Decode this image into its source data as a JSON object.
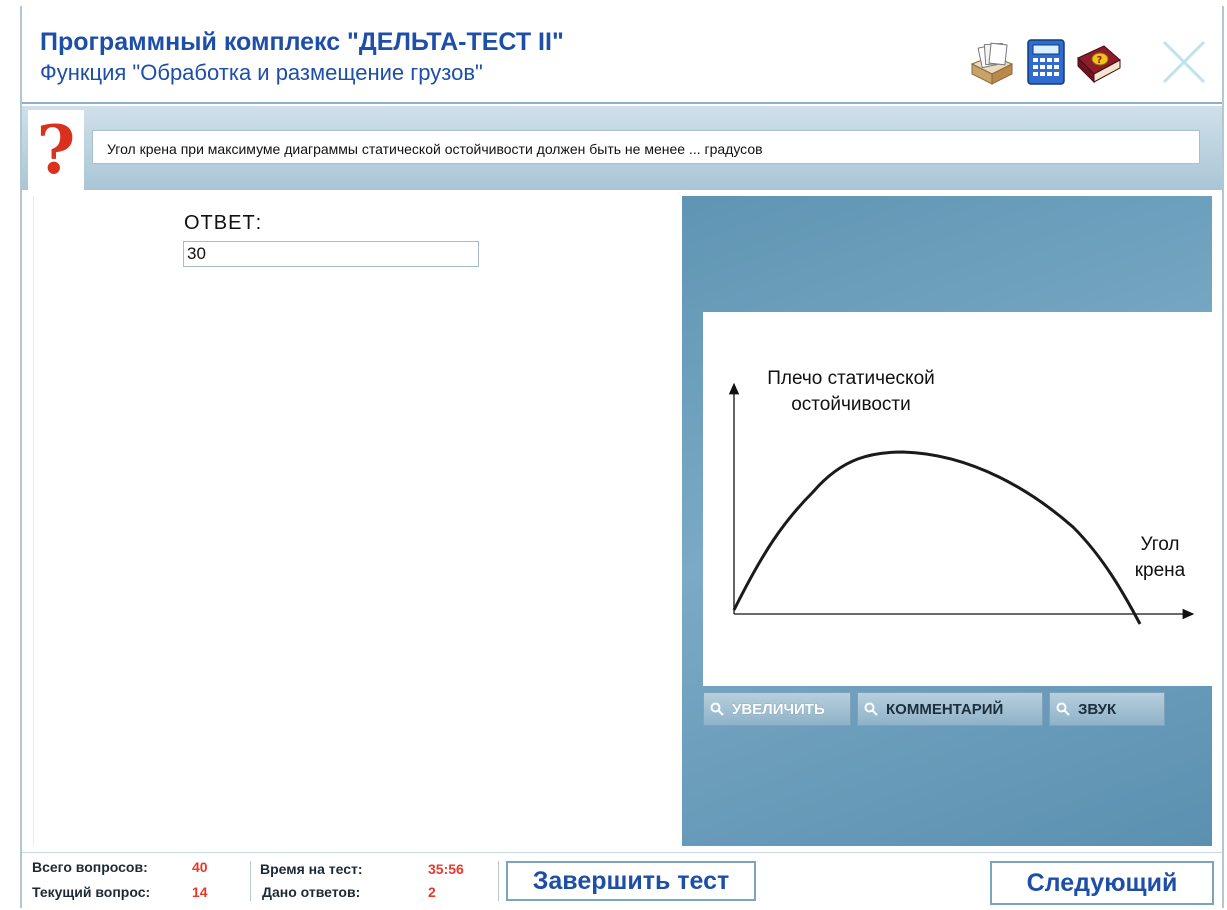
{
  "header": {
    "title": "Программный комплекс \"ДЕЛЬТА-ТЕСТ II\"",
    "subtitle": "Функция \"Обработка и размещение грузов\"",
    "icons": [
      "files-icon",
      "calculator-icon",
      "help-book-icon",
      "close-icon"
    ]
  },
  "question": {
    "text": "Угол крена при максимуме диаграммы статической остойчивости должен быть не менее ... градусов"
  },
  "answer": {
    "label": "ОТВЕТ:",
    "value": "30"
  },
  "diagram": {
    "y_label_line1": "Плечо статической",
    "y_label_line2": "остойчивости",
    "x_label_line1": "Угол",
    "x_label_line2": "крена"
  },
  "chart_data": {
    "type": "line",
    "title": "",
    "ylabel": "Плечо статической остойчивости",
    "xlabel": "Угол крена",
    "series": [],
    "grid": false
  },
  "media_buttons": {
    "zoom": "УВЕЛИЧИТЬ",
    "comment": "КОММЕНТАРИЙ",
    "sound": "ЗВУК"
  },
  "status": {
    "total_questions_label": "Всего вопросов:",
    "total_questions_value": "40",
    "current_question_label": "Текущий вопрос:",
    "current_question_value": "14",
    "time_label": "Время на тест:",
    "time_value": "35:56",
    "answers_given_label": "Дано ответов:",
    "answers_given_value": "2"
  },
  "buttons": {
    "finish_test": "Завершить тест",
    "next": "Следующий"
  },
  "colors": {
    "title_blue": "#1d4fa8",
    "accent_red": "#e8382a",
    "panel_blue": "#6b9fbd"
  }
}
